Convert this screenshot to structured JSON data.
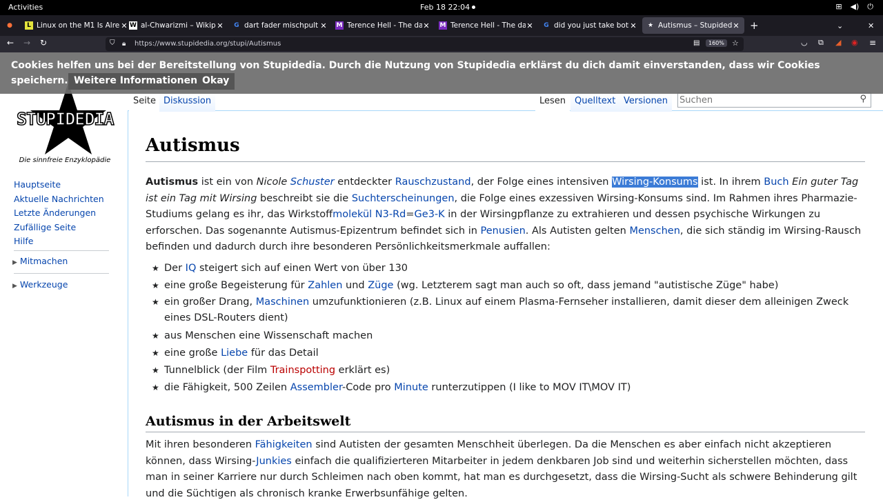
{
  "system": {
    "activities": "Activities",
    "clock": "Feb 18  22:04"
  },
  "tabs": [
    {
      "title": "Linux on the M1 Is Already..."
    },
    {
      "title": "al-Chwarizmi – Wikipedia"
    },
    {
      "title": "dart fader mischpult – Go..."
    },
    {
      "title": "Terence Hell - The darth F..."
    },
    {
      "title": "Terence Hell - The darth F..."
    },
    {
      "title": "did you just take both pills..."
    },
    {
      "title": "Autismus – Stupidedia"
    }
  ],
  "url": "https://www.stupidedia.org/stupi/Autismus",
  "zoom": "160%",
  "cookie": {
    "line1": "Cookies helfen uns bei der Bereitstellung von Stupidedia. Durch die Nutzung von Stupidedia erklärst du dich damit einverstanden, dass wir Cookies",
    "line2": "speichern.",
    "more": "Weitere Informationen",
    "okay": "Okay"
  },
  "logo": {
    "name": "STUPIDEDIA",
    "tagline": "Die sinnfreie Enzyklopädie"
  },
  "nav": [
    "Hauptseite",
    "Aktuelle Nachrichten",
    "Letzte Änderungen",
    "Zufällige Seite",
    "Hilfe"
  ],
  "portals": {
    "mitmachen": "Mitmachen",
    "werkzeuge": "Werkzeuge"
  },
  "tabs_page": {
    "seite": "Seite",
    "diskussion": "Diskussion",
    "lesen": "Lesen",
    "quelltext": "Quelltext",
    "versionen": "Versionen"
  },
  "search_placeholder": "Suchen",
  "title": "Autismus",
  "h2": "Autismus in der Arbeitswelt"
}
